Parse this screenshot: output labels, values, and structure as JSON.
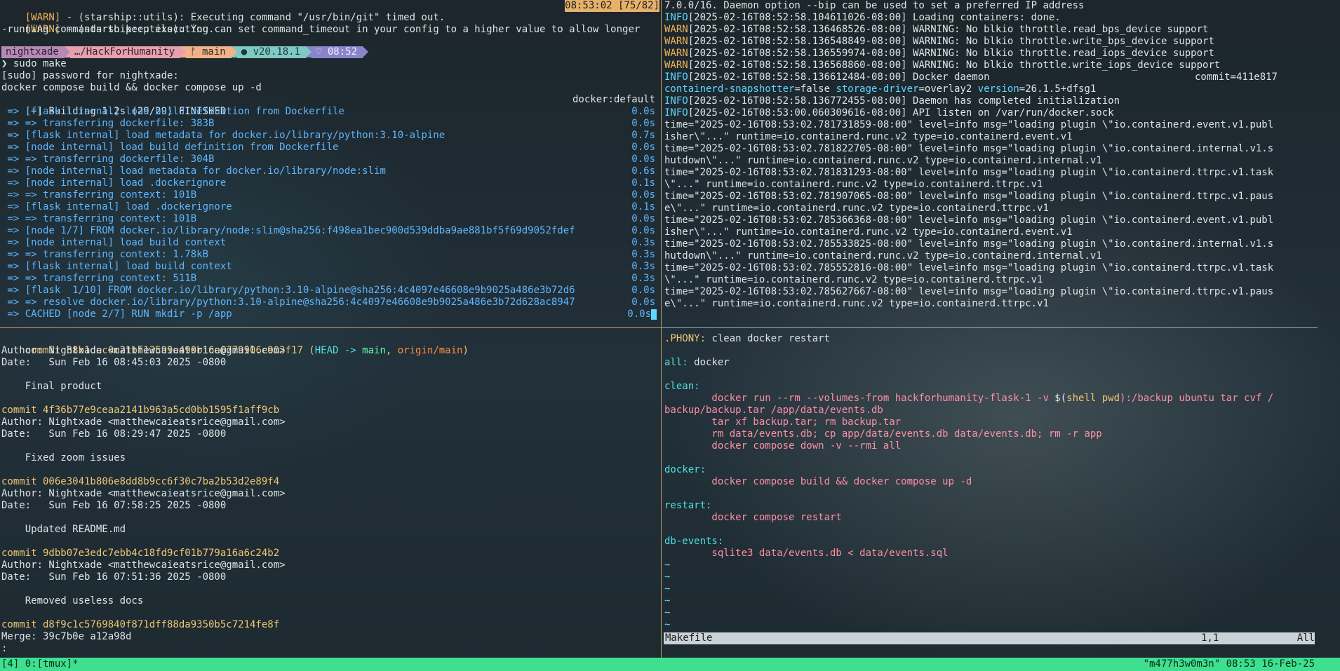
{
  "top_left": {
    "warn1": [
      "[WARN]",
      " - (starship::utils): Executing command \"/usr/bin/git\" timed out."
    ],
    "warn1_badge": "08:53:02 [75/82]",
    "warn2": [
      "[WARN]",
      " - (starship::utils): You can set command_timeout in your config to a higher value to allow longer"
    ],
    "warn2_cont": "-running commands to keep executing.",
    "prompt": {
      "user": "nightxade",
      "path": "…/HackForHumanity",
      "branch": " main",
      "node": "● v20.18.1",
      "time": "♡ 08:52"
    },
    "cmd": "❯ sudo make",
    "sudo": "[sudo] password for nightxade:",
    "compose": "docker compose build && docker compose up -d",
    "building": "[+] Building 1.2s (29/29) FINISHED",
    "building_right": "docker:default",
    "build_steps": [
      {
        "text": " => [flask internal] load build definition from Dockerfile",
        "time": "0.0s"
      },
      {
        "text": " => => transferring dockerfile: 383B",
        "time": "0.0s"
      },
      {
        "text": " => [flask internal] load metadata for docker.io/library/python:3.10-alpine",
        "time": "0.7s"
      },
      {
        "text": " => [node internal] load build definition from Dockerfile",
        "time": "0.0s"
      },
      {
        "text": " => => transferring dockerfile: 304B",
        "time": "0.0s"
      },
      {
        "text": " => [node internal] load metadata for docker.io/library/node:slim",
        "time": "0.6s"
      },
      {
        "text": " => [node internal] load .dockerignore",
        "time": "0.1s"
      },
      {
        "text": " => => transferring context: 101B",
        "time": "0.0s"
      },
      {
        "text": " => [flask internal] load .dockerignore",
        "time": "0.1s"
      },
      {
        "text": " => => transferring context: 101B",
        "time": "0.0s"
      },
      {
        "text": " => [node 1/7] FROM docker.io/library/node:slim@sha256:f498ea1bec900d539ddba9ae881bf5f69d9052fdef",
        "time": "0.0s"
      },
      {
        "text": " => [node internal] load build context",
        "time": "0.3s"
      },
      {
        "text": " => => transferring context: 1.78kB",
        "time": "0.3s"
      },
      {
        "text": " => [flask internal] load build context",
        "time": "0.3s"
      },
      {
        "text": " => => transferring context: 511B",
        "time": "0.3s"
      },
      {
        "text": " => [flask  1/10] FROM docker.io/library/python:3.10-alpine@sha256:4c4097e46608e9b9025a486e3b72d6",
        "time": "0.0s"
      },
      {
        "text": " => => resolve docker.io/library/python:3.10-alpine@sha256:4c4097e46608e9b9025a486e3b72d628ac8947",
        "time": "0.0s"
      },
      {
        "text": " => CACHED [node 2/7] RUN mkdir -p /app",
        "time": "0.0s"
      }
    ]
  },
  "top_right": {
    "lines": [
      {
        "type": "plain",
        "text": "7.0.0/16. Daemon option --bip can be used to set a preferred IP address"
      },
      {
        "type": "info",
        "tag": "INFO",
        "text": "[2025-02-16T08:52:58.104611026-08:00] Loading containers: done."
      },
      {
        "type": "warn",
        "tag": "WARN",
        "text": "[2025-02-16T08:52:58.136468526-08:00] WARNING: No blkio throttle.read_bps_device support"
      },
      {
        "type": "warn",
        "tag": "WARN",
        "text": "[2025-02-16T08:52:58.136548849-08:00] WARNING: No blkio throttle.write_bps_device support"
      },
      {
        "type": "warn",
        "tag": "WARN",
        "text": "[2025-02-16T08:52:58.136559974-08:00] WARNING: No blkio throttle.read_iops_device support"
      },
      {
        "type": "warn",
        "tag": "WARN",
        "text": "[2025-02-16T08:52:58.136568860-08:00] WARNING: No blkio throttle.write_iops_device support"
      },
      {
        "type": "info",
        "tag": "INFO",
        "text": "[2025-02-16T08:52:58.136612484-08:00] Docker daemon",
        "right": "commit=411e817"
      },
      {
        "type": "plain",
        "text": "containerd-snapshotter=false storage-driver=overlay2 version=26.1.5+dfsg1"
      },
      {
        "type": "info",
        "tag": "INFO",
        "text": "[2025-02-16T08:52:58.136772455-08:00] Daemon has completed initialization"
      },
      {
        "type": "info",
        "tag": "INFO",
        "text": "[2025-02-16T08:53:00.060309616-08:00] API listen on /var/run/docker.sock"
      },
      {
        "type": "plain",
        "text": "time=\"2025-02-16T08:53:02.781731859-08:00\" level=info msg=\"loading plugin \\\"io.containerd.event.v1.publ"
      },
      {
        "type": "plain",
        "text": "isher\\\"...\" runtime=io.containerd.runc.v2 type=io.containerd.event.v1"
      },
      {
        "type": "plain",
        "text": "time=\"2025-02-16T08:53:02.781822705-08:00\" level=info msg=\"loading plugin \\\"io.containerd.internal.v1.s"
      },
      {
        "type": "plain",
        "text": "hutdown\\\"...\" runtime=io.containerd.runc.v2 type=io.containerd.internal.v1"
      },
      {
        "type": "plain",
        "text": "time=\"2025-02-16T08:53:02.781831293-08:00\" level=info msg=\"loading plugin \\\"io.containerd.ttrpc.v1.task"
      },
      {
        "type": "plain",
        "text": "\\\"...\" runtime=io.containerd.runc.v2 type=io.containerd.ttrpc.v1"
      },
      {
        "type": "plain",
        "text": "time=\"2025-02-16T08:53:02.781907065-08:00\" level=info msg=\"loading plugin \\\"io.containerd.ttrpc.v1.paus"
      },
      {
        "type": "plain",
        "text": "e\\\"...\" runtime=io.containerd.runc.v2 type=io.containerd.ttrpc.v1"
      },
      {
        "type": "plain",
        "text": "time=\"2025-02-16T08:53:02.785366368-08:00\" level=info msg=\"loading plugin \\\"io.containerd.event.v1.publ"
      },
      {
        "type": "plain",
        "text": "isher\\\"...\" runtime=io.containerd.runc.v2 type=io.containerd.event.v1"
      },
      {
        "type": "plain",
        "text": "time=\"2025-02-16T08:53:02.785533825-08:00\" level=info msg=\"loading plugin \\\"io.containerd.internal.v1.s"
      },
      {
        "type": "plain",
        "text": "hutdown\\\"...\" runtime=io.containerd.runc.v2 type=io.containerd.internal.v1"
      },
      {
        "type": "plain",
        "text": "time=\"2025-02-16T08:53:02.785552816-08:00\" level=info msg=\"loading plugin \\\"io.containerd.ttrpc.v1.task"
      },
      {
        "type": "plain",
        "text": "\\\"...\" runtime=io.containerd.runc.v2 type=io.containerd.ttrpc.v1"
      },
      {
        "type": "plain",
        "text": "time=\"2025-02-16T08:53:02.785627667-08:00\" level=info msg=\"loading plugin \\\"io.containerd.ttrpc.v1.paus"
      },
      {
        "type": "plain",
        "text": "e\\\"...\" runtime=io.containerd.runc.v2 type=io.containerd.ttrpc.v1"
      }
    ]
  },
  "git_log": {
    "first_commit": {
      "hash": "commit 38b1dac0c21bf13599a490b16a6779906e903f17",
      "open": " (",
      "head": "HEAD -> ",
      "branch": "main",
      "sep": ", ",
      "origin": "origin/main",
      "close": ")"
    },
    "lines": [
      {
        "type": "text",
        "text": "Author: Nightxade <matthewcaieatsrice@gmail.com>"
      },
      {
        "type": "text",
        "text": "Date:   Sun Feb 16 08:45:03 2025 -0800"
      },
      {
        "type": "blank",
        "text": ""
      },
      {
        "type": "text",
        "text": "    Final product"
      },
      {
        "type": "blank",
        "text": ""
      },
      {
        "type": "commit",
        "text": "commit 4f36b77e9ceaa2141b963a5cd0bb1595f1aff9cb"
      },
      {
        "type": "text",
        "text": "Author: Nightxade <matthewcaieatsrice@gmail.com>"
      },
      {
        "type": "text",
        "text": "Date:   Sun Feb 16 08:29:47 2025 -0800"
      },
      {
        "type": "blank",
        "text": ""
      },
      {
        "type": "text",
        "text": "    Fixed zoom issues"
      },
      {
        "type": "blank",
        "text": ""
      },
      {
        "type": "commit",
        "text": "commit 006e3041b806e8dd8b9cc6f30c7ba2b53d2e89f4"
      },
      {
        "type": "text",
        "text": "Author: Nightxade <matthewcaieatsrice@gmail.com>"
      },
      {
        "type": "text",
        "text": "Date:   Sun Feb 16 07:58:25 2025 -0800"
      },
      {
        "type": "blank",
        "text": ""
      },
      {
        "type": "text",
        "text": "    Updated README.md"
      },
      {
        "type": "blank",
        "text": ""
      },
      {
        "type": "commit",
        "text": "commit 9dbb07e3edc7ebb4c18fd9cf01b779a16a6c24b2"
      },
      {
        "type": "text",
        "text": "Author: Nightxade <matthewcaieatsrice@gmail.com>"
      },
      {
        "type": "text",
        "text": "Date:   Sun Feb 16 07:51:36 2025 -0800"
      },
      {
        "type": "blank",
        "text": ""
      },
      {
        "type": "text",
        "text": "    Removed useless docs"
      },
      {
        "type": "blank",
        "text": ""
      },
      {
        "type": "commit",
        "text": "commit d8f9c1c5769840f871dff88da9350b5c7214fe8f"
      },
      {
        "type": "text",
        "text": "Merge: 39c7b0e a12a98d"
      },
      {
        "type": "text",
        "text": ":"
      }
    ]
  },
  "makefile": {
    "phony_key": ".PHONY:",
    "phony_val": " clean docker restart",
    "lines": [
      {
        "type": "blank",
        "text": ""
      },
      {
        "type": "targetval",
        "key": "all:",
        "val": " docker"
      },
      {
        "type": "blank",
        "text": ""
      },
      {
        "type": "target",
        "text": "clean:"
      },
      {
        "type": "cmdspecial",
        "pre": "        docker run --rm --volumes-from hackforhumanity-flask-1 -v ",
        "dollar": "$(",
        "shell": "shell",
        "sp": " ",
        "pwd": "pwd",
        "post": "):/backup ubuntu tar cvf /"
      },
      {
        "type": "cmdnoindent",
        "text": "backup/backup.tar /app/data/events.db"
      },
      {
        "type": "cmd",
        "text": "        tar xf backup.tar; rm backup.tar"
      },
      {
        "type": "cmd",
        "text": "        rm data/events.db; cp app/data/events.db data/events.db; rm -r app"
      },
      {
        "type": "cmd",
        "text": "        docker compose down -v --rmi all"
      },
      {
        "type": "blank",
        "text": ""
      },
      {
        "type": "target",
        "text": "docker:"
      },
      {
        "type": "cmd",
        "text": "        docker compose build && docker compose up -d"
      },
      {
        "type": "blank",
        "text": ""
      },
      {
        "type": "target",
        "text": "restart:"
      },
      {
        "type": "cmd",
        "text": "        docker compose restart"
      },
      {
        "type": "blank",
        "text": ""
      },
      {
        "type": "target",
        "text": "db-events:"
      },
      {
        "type": "cmd",
        "text": "        sqlite3 data/events.db < data/events.sql"
      },
      {
        "type": "tilde",
        "text": "~"
      },
      {
        "type": "tilde",
        "text": "~"
      },
      {
        "type": "tilde",
        "text": "~"
      },
      {
        "type": "tilde",
        "text": "~"
      },
      {
        "type": "tilde",
        "text": "~"
      },
      {
        "type": "tilde",
        "text": "~"
      }
    ],
    "status_file": "Makefile",
    "status_pos": "1,1",
    "status_all": "All"
  },
  "tmux": {
    "left": "[4] 0:[tmux]*",
    "right": "\"m477h3w0m3n\" 08:53 16-Feb-25"
  },
  "colors": {
    "tmux_bar": "#3ee08f",
    "pane_border": "#b89a6a",
    "info": "#5fd7ff",
    "warn": "#f0b35a"
  }
}
